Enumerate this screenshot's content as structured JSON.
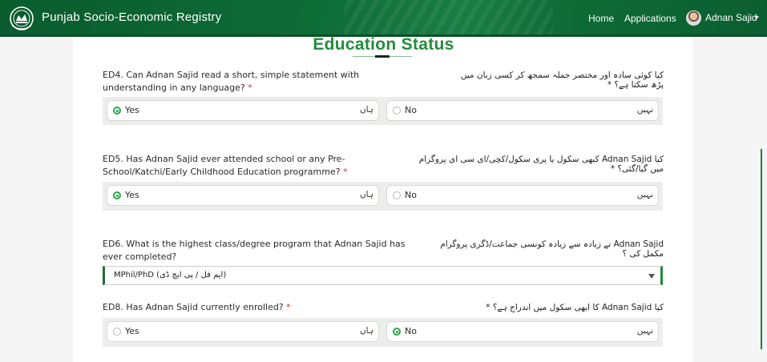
{
  "header": {
    "brand": "Punjab Socio-Economic Registry",
    "nav": {
      "home": "Home",
      "applications": "Applications"
    },
    "user": {
      "name": "Adnan Sajid"
    }
  },
  "section": {
    "title": "Education Status"
  },
  "questions": [
    {
      "text_en": "ED4. Can Adnan Sajid read a short, simple statement with",
      "text_en_2": "understanding in any language?",
      "required": "*",
      "text_ur": "کیا کوئی سادہ اور مختصر جملہ سمجھ کر کسی زبان میں پڑھ سکتا ہے؟ *",
      "options": [
        {
          "label": "Yes",
          "label_ur": "ہاں",
          "selected": true
        },
        {
          "label": "No",
          "label_ur": "نہیں",
          "selected": false
        }
      ]
    },
    {
      "text_en": "ED5. Has Adnan Sajid ever attended school or any Pre-",
      "text_en_2": "School/Katchi/Early Childhood Education programme?",
      "required": "*",
      "text_ur": "کیا Adnan Sajid کبھی سکول یا پری سکول/کچی/ای سی ای پروگرام میں گیا/گئی؟ *",
      "options": [
        {
          "label": "Yes",
          "label_ur": "ہاں",
          "selected": true
        },
        {
          "label": "No",
          "label_ur": "نہیں",
          "selected": false
        }
      ]
    },
    {
      "text_en": "ED6. What is the highest class/degree program that Adnan Sajid has",
      "text_en_2": "ever completed?",
      "text_ur": "Adnan Sajid نے زیادہ سے زیادہ کونسی جماعت/ڈگری پروگرام مکمل کی ؟",
      "select_value": "MPhil/PhD (ایم فل / پی ایچ ڈی)"
    },
    {
      "text_en": "ED8. Has Adnan Sajid currently enrolled?",
      "required": "*",
      "text_ur": "کیا Adnan Sajid کا ابھی سکول میں اندراج ہے؟ *",
      "options": [
        {
          "label": "Yes",
          "label_ur": "ہاں",
          "selected": false
        },
        {
          "label": "No",
          "label_ur": "نہیں",
          "selected": true
        }
      ]
    }
  ],
  "colors": {
    "header_green": "#0d6b36",
    "title_green": "#238c3b",
    "radio_green": "#2aa74d",
    "required_red": "#d9322b"
  }
}
